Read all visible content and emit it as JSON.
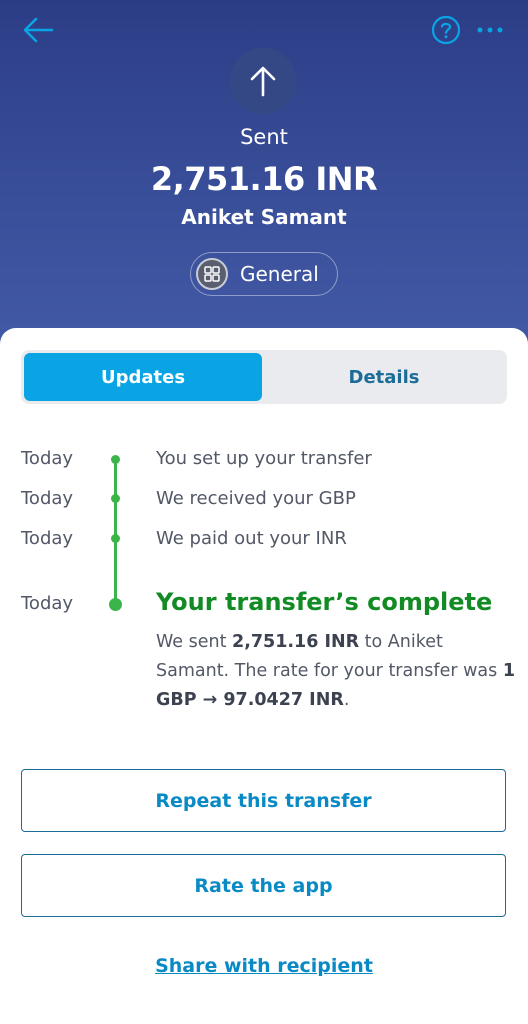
{
  "header": {
    "status": "Sent",
    "amount": "2,751.16 INR",
    "recipient": "Aniket Samant",
    "category": "General"
  },
  "tabs": [
    {
      "label": "Updates",
      "active": true
    },
    {
      "label": "Details",
      "active": false
    }
  ],
  "timeline": [
    {
      "date": "Today",
      "text": "You set up your transfer"
    },
    {
      "date": "Today",
      "text": "We received your GBP"
    },
    {
      "date": "Today",
      "text": "We paid out your INR"
    },
    {
      "date": "Today",
      "text": "Your transfer’s complete"
    }
  ],
  "completion": {
    "part1": "We sent ",
    "amount": "2,751.16 INR",
    "part2": " to Aniket Samant. The rate for your transfer was ",
    "rate": "1 GBP → 97.0427 INR",
    "part3": "."
  },
  "actions": {
    "repeat_label": "Repeat this transfer",
    "rate_label": "Rate the app",
    "share_label": "Share with recipient"
  },
  "colors": {
    "header_bg": "#34488f",
    "accent_blue": "#0aa4e4",
    "success_green": "#3bb54a",
    "link_blue": "#0a8ac4"
  }
}
